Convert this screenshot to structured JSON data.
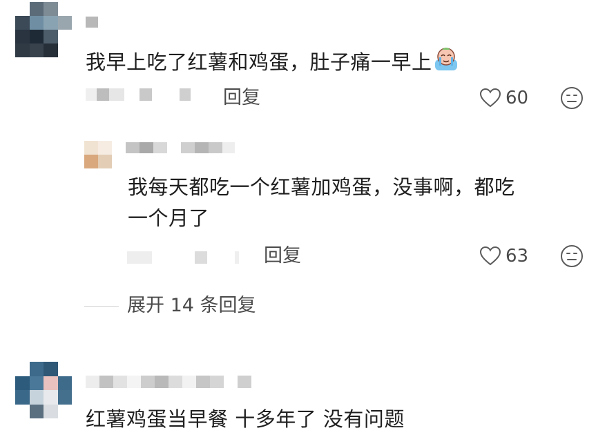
{
  "comments": [
    {
      "text": "我早上吃了红薯和鸡蛋，肚子痛一早上",
      "reply_label": "回复",
      "likes": "60",
      "reply": {
        "text_line1": "我每天都吃一个红薯加鸡蛋，没事啊，都吃",
        "text_line2": "一个月了",
        "reply_label": "回复",
        "likes": "63"
      },
      "expand_label": "展开 14 条回复"
    },
    {
      "text": "红薯鸡蛋当早餐 十多年了 没有问题"
    }
  ],
  "icons": {
    "like": "heart-outline-icon",
    "dislike": "neutral-face-icon",
    "sticker": "crying-emoji-sticker"
  },
  "colors": {
    "text": "#1f1f1f",
    "meta": "#4a4a4a",
    "icon": "#5a5a5a"
  }
}
